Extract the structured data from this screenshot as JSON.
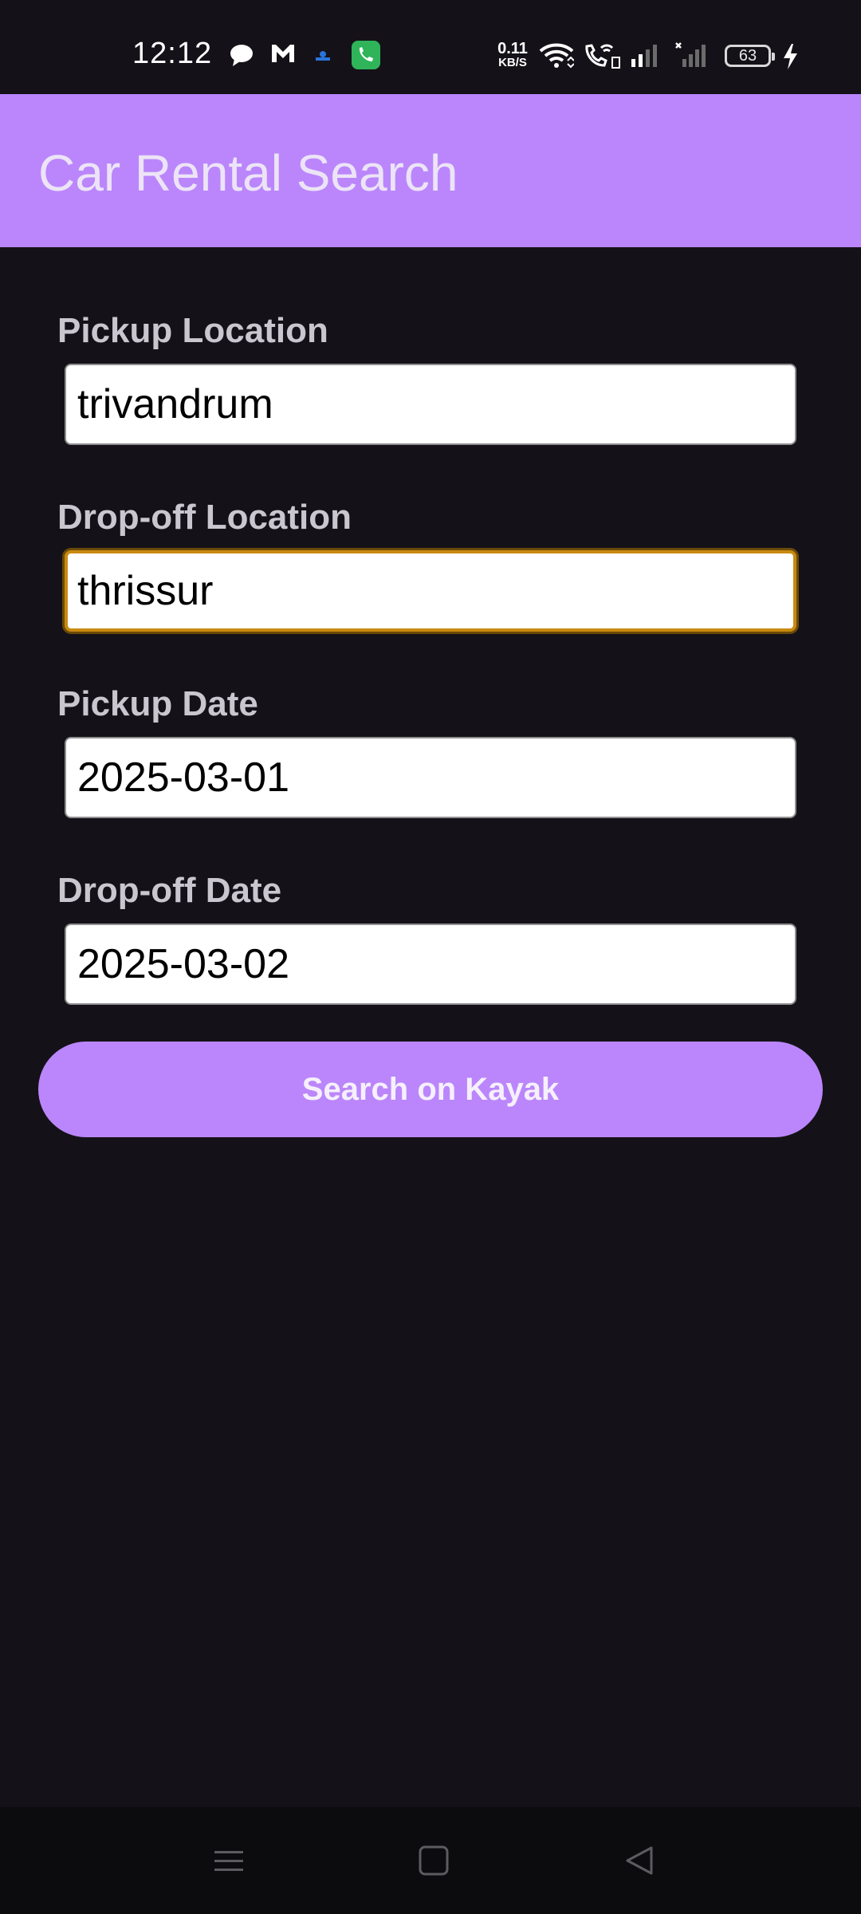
{
  "status_bar": {
    "time": "12:12",
    "net_speed_value": "0.11",
    "net_speed_unit": "KB/S",
    "battery_level": "63",
    "icons": [
      "chat-icon",
      "gmail-icon",
      "notification-icon",
      "phone-app-icon",
      "wifi-icon",
      "wifi-calling-icon",
      "signal-icon",
      "signal-no-service-icon",
      "battery-icon",
      "charging-icon"
    ]
  },
  "app_bar": {
    "title": "Car Rental Search"
  },
  "form": {
    "pickup_location": {
      "label": "Pickup Location",
      "value": "trivandrum"
    },
    "dropoff_location": {
      "label": "Drop-off Location",
      "value": "thrissur"
    },
    "pickup_date": {
      "label": "Pickup Date",
      "value": "2025-03-01"
    },
    "dropoff_date": {
      "label": "Drop-off Date",
      "value": "2025-03-02"
    },
    "search_button_label": "Search on Kayak"
  },
  "nav_bar": {
    "icons": [
      "menu-icon",
      "home-icon",
      "back-icon"
    ]
  },
  "colors": {
    "background": "#141218",
    "accent": "#bb86fc",
    "focus_border": "#c98a10"
  }
}
